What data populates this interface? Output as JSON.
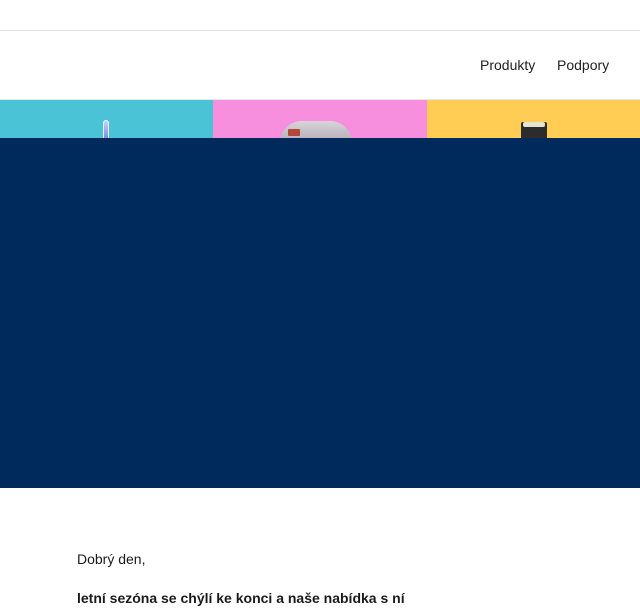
{
  "nav": {
    "items": [
      {
        "label": "Produkty"
      },
      {
        "label": "Podpory"
      }
    ]
  },
  "banner": {
    "tiles": [
      {
        "color": "#4ac3d6",
        "product_icon": "toothbrush-icon"
      },
      {
        "color": "#f78fde",
        "product_icon": "ipl-device-icon"
      },
      {
        "color": "#ffcd54",
        "product_icon": "shaver-icon"
      }
    ]
  },
  "hero": {
    "color": "#012a5c"
  },
  "content": {
    "greeting": "Dobrý den,",
    "lead": "letní sezóna se chýlí ke konci a naše nabídka s ní"
  }
}
